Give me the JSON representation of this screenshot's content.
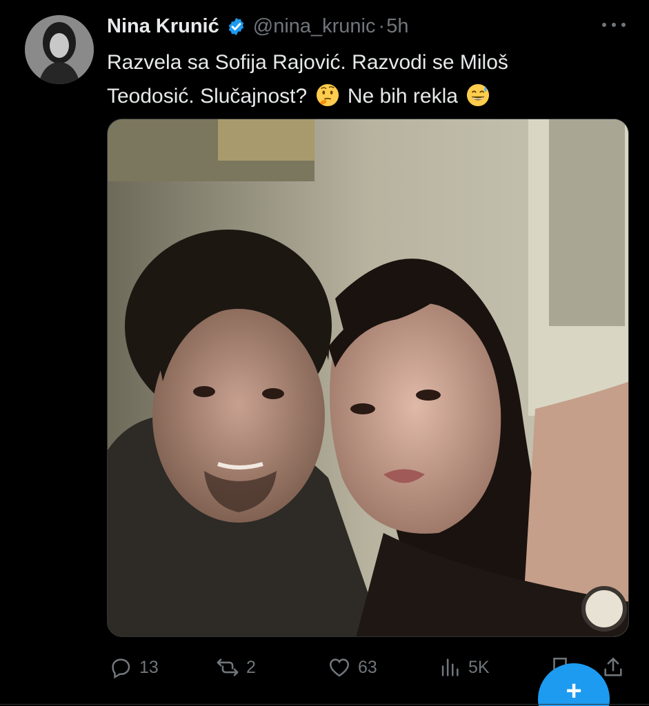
{
  "tweet": {
    "author": {
      "name": "Nina Krunić",
      "handle": "@nina_krunic",
      "verified": true
    },
    "separator_dot": "·",
    "time": "5h",
    "text_line1": "Razvela sa Sofija Rajović. Razvodi se Miloš",
    "text_line2_part1": "Teodosić. Slučajnost?",
    "text_line2_part2": "Ne bih rekla",
    "emojis": [
      "thinking-face-emoji",
      "grinning-sweat-emoji"
    ]
  },
  "actions": {
    "replies": "13",
    "retweets": "2",
    "likes": "63",
    "views": "5K"
  },
  "fab": {
    "label": "+"
  },
  "colors": {
    "background": "#000000",
    "text": "#e7e9ea",
    "secondary": "#71767b",
    "accent": "#1d9bf0"
  }
}
